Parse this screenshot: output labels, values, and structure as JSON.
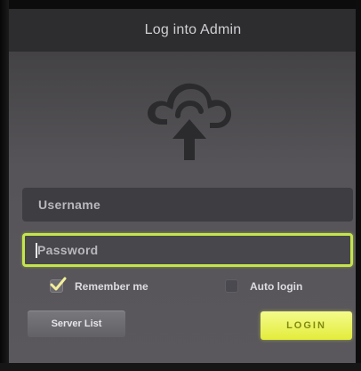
{
  "header": {
    "title": "Log into Admin"
  },
  "logo": {
    "icon": "cloud-upload-icon"
  },
  "form": {
    "username_placeholder": "Username",
    "password_placeholder": "Password",
    "password_focused": true,
    "remember_label": "Remember me",
    "remember_checked": true,
    "auto_login_label": "Auto login",
    "auto_login_checked": false
  },
  "buttons": {
    "server_list_label": "Server List",
    "login_label": "LOGIN"
  },
  "colors": {
    "focus_border": "#c4e64c",
    "login_button": "#e9f150",
    "title_bar": "#2d2c2e"
  }
}
